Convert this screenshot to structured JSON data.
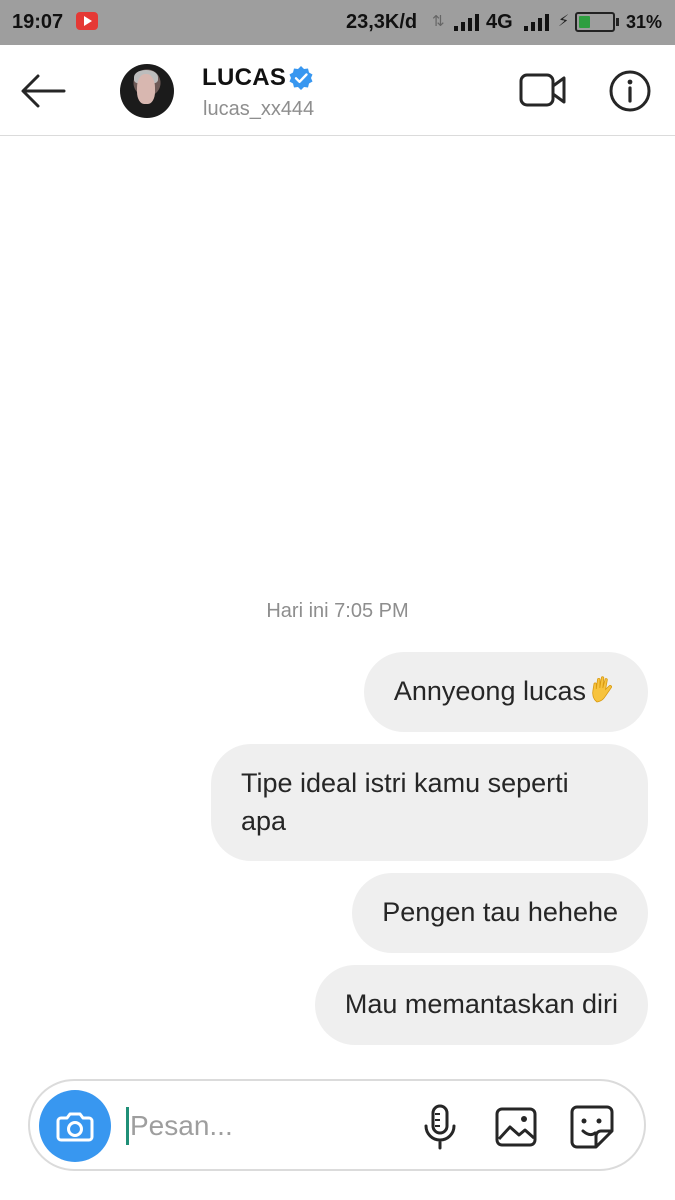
{
  "status_bar": {
    "time": "19:07",
    "speed": "23,3K/d",
    "data_arrows": "⇅",
    "network": "4G",
    "battery_level": 0.31,
    "battery_percent": "31%",
    "icons": [
      "youtube-notification-icon",
      "signal-icon",
      "signal-icon",
      "charging-bolt-icon",
      "battery-icon"
    ]
  },
  "header": {
    "name": "LUCAS",
    "username": "lucas_xx444",
    "verified": true,
    "icons": [
      "back-arrow-icon",
      "video-call-icon",
      "info-icon",
      "verified-badge-icon"
    ]
  },
  "conversation": {
    "timestamp": "Hari ini 7:05 PM",
    "messages": [
      {
        "text": "Annyeong lucas",
        "emoji": "raised-hand"
      },
      {
        "text": "Tipe ideal istri kamu seperti apa"
      },
      {
        "text": "Pengen tau hehehe"
      },
      {
        "text": "Mau memantaskan diri"
      }
    ]
  },
  "composer": {
    "placeholder": "Pesan...",
    "value": "",
    "icons": [
      "camera-icon",
      "microphone-icon",
      "gallery-icon",
      "sticker-icon"
    ]
  },
  "colors": {
    "status_bar": "#9e9e9e",
    "bubble": "#efefef",
    "accent": "#3897f0",
    "verified": "#3897f0"
  }
}
